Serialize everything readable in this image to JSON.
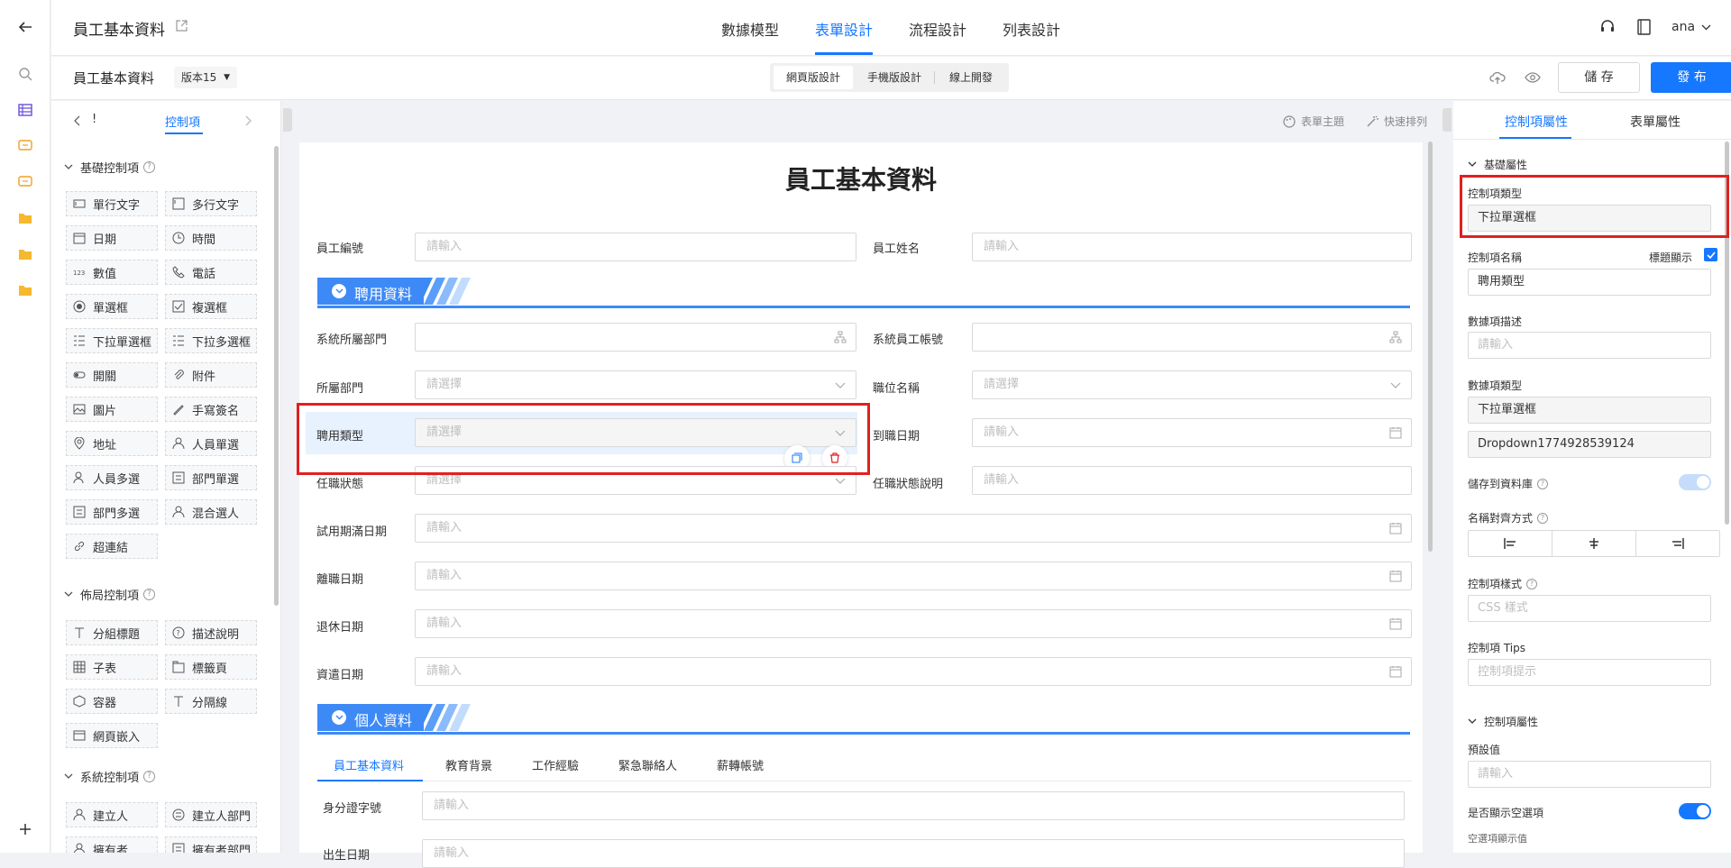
{
  "app": {
    "title": "員工基本資料",
    "user": "ana"
  },
  "nav_tabs": [
    {
      "label": "數據模型"
    },
    {
      "label": "表單設計"
    },
    {
      "label": "流程設計"
    },
    {
      "label": "列表設計"
    }
  ],
  "toolbar": {
    "form_name": "員工基本資料",
    "version": "版本15",
    "modes": [
      "網頁版設計",
      "手機版設計",
      "線上開發"
    ],
    "save": "儲 存",
    "publish": "發 布"
  },
  "left_panel": {
    "back_label": "!",
    "tab": "控制項",
    "sections": [
      {
        "title": "基礎控制項",
        "items": [
          "單行文字",
          "多行文字",
          "日期",
          "時間",
          "數值",
          "電話",
          "單選框",
          "複選框",
          "下拉單選框",
          "下拉多選框",
          "開關",
          "附件",
          "圖片",
          "手寫簽名",
          "地址",
          "人員單選",
          "人員多選",
          "部門單選",
          "部門多選",
          "混合選人",
          "超連結"
        ]
      },
      {
        "title": "佈局控制項",
        "items": [
          "分組標題",
          "描述說明",
          "子表",
          "標籤頁",
          "容器",
          "分隔線",
          "網頁嵌入"
        ]
      },
      {
        "title": "系統控制項",
        "items": [
          "建立人",
          "建立人部門",
          "擁有者",
          "擁有者部門"
        ]
      }
    ]
  },
  "canvas": {
    "actions": [
      "表單主題",
      "快速排列"
    ],
    "form_title": "員工基本資料",
    "input_ph": "請輸入",
    "select_ph": "請選擇",
    "labels": {
      "emp_no": "員工編號",
      "emp_name": "員工姓名",
      "sys_dept": "系統所屬部門",
      "sys_account": "系統員工帳號",
      "dept": "所屬部門",
      "position": "職位名稱",
      "hire_type": "聘用類型",
      "join_date": "到職日期",
      "status": "任職狀態",
      "status_desc": "任職狀態說明",
      "probation_end": "試用期滿日期",
      "leave_date": "離職日期",
      "retire_date": "退休日期",
      "seniority_date": "資遣日期",
      "id_no": "身分證字號",
      "birth": "出生日期"
    },
    "section1": "聘用資料",
    "section2": "個人資料",
    "subtabs": [
      "員工基本資料",
      "教育背景",
      "工作經驗",
      "緊急聯絡人",
      "薪轉帳號"
    ]
  },
  "right_panel": {
    "tabs": [
      "控制項屬性",
      "表單屬性"
    ],
    "basic_title": "基礎屬性",
    "ctrl_type_label": "控制項類型",
    "ctrl_type_value": "下拉單選框",
    "ctrl_name_label": "控制項名稱",
    "show_title_label": "標題顯示",
    "ctrl_name_value": "聘用類型",
    "desc_label": "數據項描述",
    "desc_ph": "請輸入",
    "data_type_label": "數據項類型",
    "data_type_value": "下拉單選框",
    "data_id": "Dropdown1774928539124",
    "save_db_label": "儲存到資料庫",
    "align_label": "名稱對齊方式",
    "style_label": "控制項樣式",
    "style_ph": "CSS 樣式",
    "tips_label": "控制項 Tips",
    "tips_ph": "控制項提示",
    "ctrl_attr_title": "控制項屬性",
    "default_label": "預設值",
    "default_ph": "請輸入",
    "show_empty_label": "是否顯示空選項",
    "empty_display_label": "空選項顯示值"
  },
  "colors": {
    "accent": "#1677ff",
    "highlight": "#e02020",
    "banner": "#2f7ff0"
  }
}
